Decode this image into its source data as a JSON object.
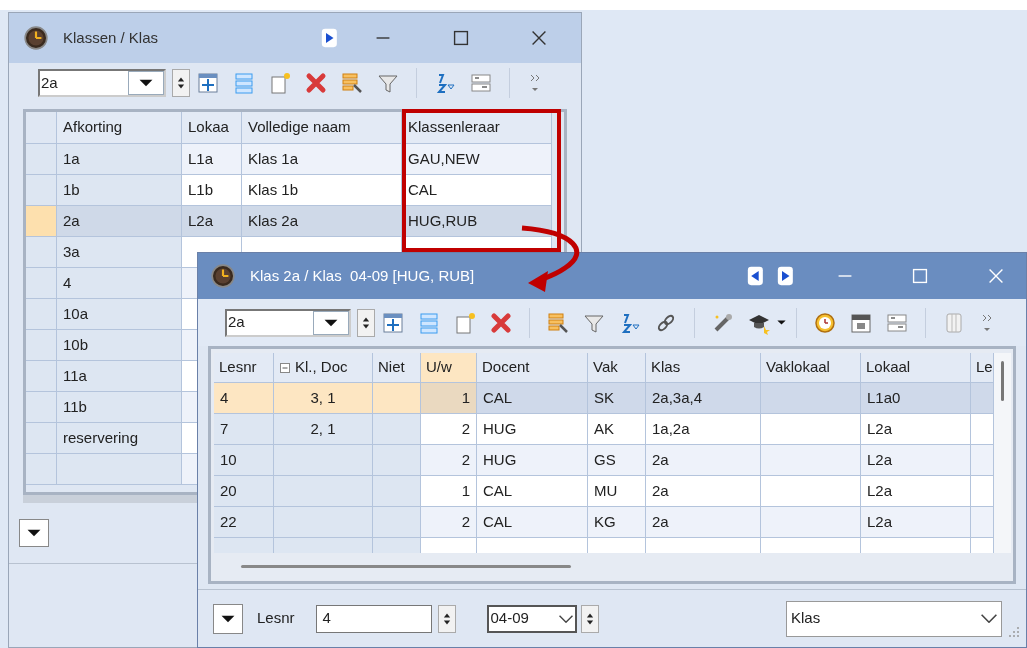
{
  "class_list_window": {
    "title": "Klassen / Klas",
    "selector": "2a",
    "table": {
      "columns": [
        "Afkorting",
        "Lokaa",
        "Volledige naam",
        "Klassenleraar"
      ],
      "rows": [
        {
          "cells": [
            "1a",
            "L1a",
            "Klas 1a",
            "GAU,NEW"
          ],
          "selected": false
        },
        {
          "cells": [
            "1b",
            "L1b",
            "Klas 1b",
            "CAL"
          ],
          "selected": false
        },
        {
          "cells": [
            "2a",
            "L2a",
            "Klas 2a",
            "HUG,RUB"
          ],
          "selected": true
        },
        {
          "cells": [
            "3a",
            null,
            null,
            null
          ],
          "selected": false
        },
        {
          "cells": [
            "4",
            null,
            null,
            null
          ],
          "selected": false
        },
        {
          "cells": [
            "10a",
            null,
            null,
            null
          ],
          "selected": false
        },
        {
          "cells": [
            "10b",
            null,
            null,
            null
          ],
          "selected": false
        },
        {
          "cells": [
            "11a",
            null,
            null,
            null
          ],
          "selected": false
        },
        {
          "cells": [
            "11b",
            null,
            null,
            null
          ],
          "selected": false
        },
        {
          "cells": [
            "reservering",
            null,
            null,
            null
          ],
          "selected": false
        }
      ]
    }
  },
  "class_window": {
    "title": "Klas 2a / Klas  04-09 [HUG, RUB]",
    "selector": "2a",
    "table": {
      "columns": [
        {
          "label": "Lesnr",
          "selected": false,
          "collapsible": false
        },
        {
          "label": "Kl., Doc",
          "selected": false,
          "collapsible": true
        },
        {
          "label": "Niet",
          "selected": false,
          "collapsible": false
        },
        {
          "label": "U/w",
          "selected": true,
          "collapsible": false
        },
        {
          "label": "Docent",
          "selected": false,
          "collapsible": false
        },
        {
          "label": "Vak",
          "selected": false,
          "collapsible": false
        },
        {
          "label": "Klas",
          "selected": false,
          "collapsible": false
        },
        {
          "label": "Vaklokaal",
          "selected": false,
          "collapsible": false
        },
        {
          "label": "Lokaal",
          "selected": false,
          "collapsible": false
        },
        {
          "label": "Le",
          "selected": false,
          "collapsible": false
        }
      ],
      "rows": [
        {
          "cells": [
            "4",
            "3, 1",
            null,
            "1",
            "CAL",
            "SK",
            "2a,3a,4",
            null,
            "L1a0",
            null
          ],
          "selected": true
        },
        {
          "cells": [
            "7",
            "2, 1",
            null,
            "2",
            "HUG",
            "AK",
            "1a,2a",
            null,
            "L2a",
            null
          ],
          "selected": false
        },
        {
          "cells": [
            "10",
            null,
            null,
            "2",
            "HUG",
            "GS",
            "2a",
            null,
            "L2a",
            null
          ],
          "selected": false
        },
        {
          "cells": [
            "20",
            null,
            null,
            "1",
            "CAL",
            "MU",
            "2a",
            null,
            "L2a",
            null
          ],
          "selected": false
        },
        {
          "cells": [
            "22",
            null,
            null,
            "2",
            "CAL",
            "KG",
            "2a",
            null,
            "L2a",
            null
          ],
          "selected": false
        }
      ]
    },
    "footer": {
      "lesnr_label": "Lesnr",
      "lesnr_value": "4",
      "period": "04-09",
      "view": "Klas"
    }
  }
}
